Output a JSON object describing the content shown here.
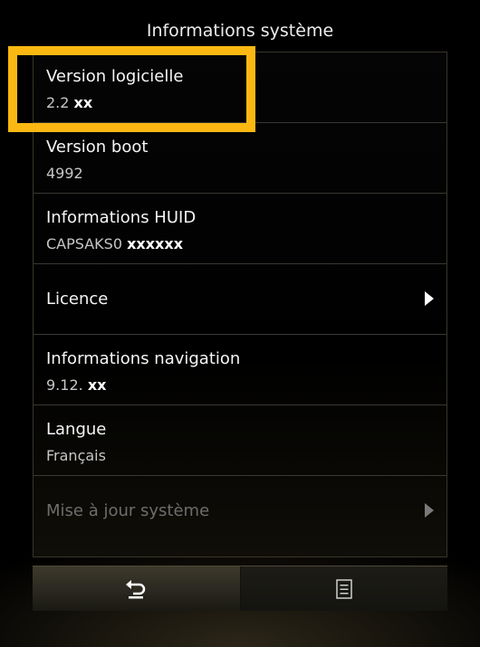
{
  "header": {
    "title": "Informations système"
  },
  "items": [
    {
      "label": "Version logicielle",
      "value": "2.2",
      "value_suffix": "xx"
    },
    {
      "label": "Version boot",
      "value": "4992"
    },
    {
      "label": "Informations HUID",
      "value": "CAPSAKS0",
      "value_suffix": "xxxxxx"
    },
    {
      "label": "Licence"
    },
    {
      "label": "Informations navigation",
      "value": "9.12.",
      "value_suffix": "xx"
    },
    {
      "label": "Langue",
      "value": "Français"
    },
    {
      "label": "Mise à jour système"
    }
  ],
  "icons": {
    "back": "back-arrow-icon",
    "menu": "menu-list-icon",
    "chevron": "chevron-right-icon"
  },
  "colors": {
    "highlight": "#fbb812",
    "background": "#000000",
    "disabled_text": "#6d6d6d"
  }
}
